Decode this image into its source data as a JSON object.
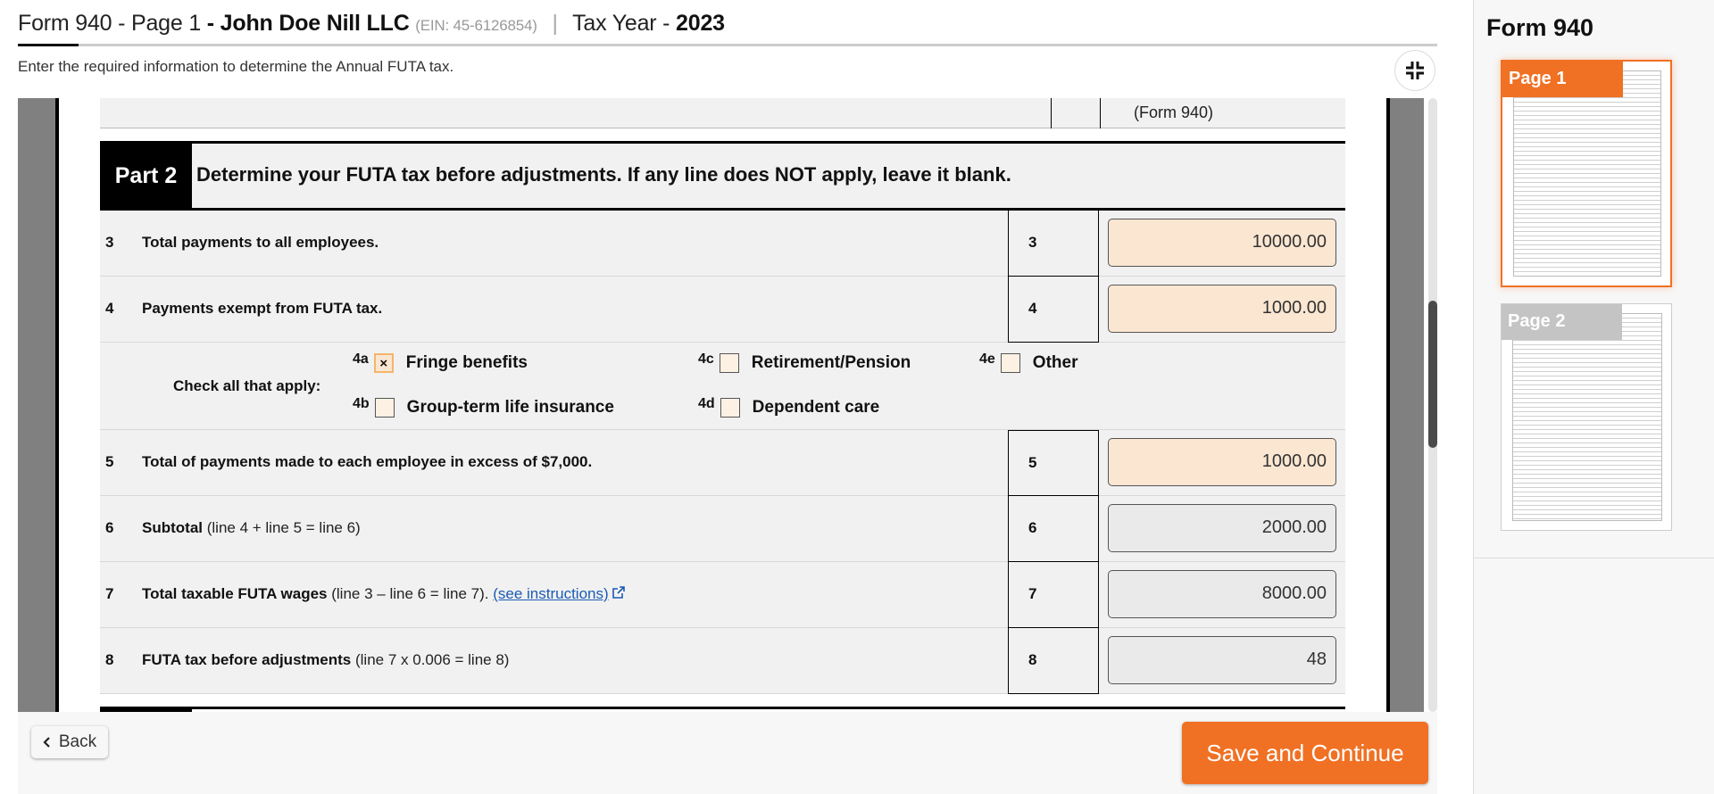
{
  "header": {
    "form_label": "Form 940 - Page 1",
    "company_prefix": " - ",
    "company": "John Doe Nill LLC",
    "ein": "(EIN: 45-6126854)",
    "separator": "|",
    "tax_year_label": "Tax Year - ",
    "tax_year": "2023",
    "subtitle": "Enter the required information to determine the Annual FUTA tax.",
    "collapse_icon": "collapse-arrows-icon"
  },
  "form": {
    "prev_row_text": "(Form 940)",
    "part": {
      "label": "Part 2",
      "title": "Determine your FUTA tax before adjustments. If any line does NOT apply, leave it blank."
    },
    "lines": [
      {
        "num": "3",
        "bold": "Total payments to all employees.",
        "rest": "",
        "line_no": "3",
        "value": "10000.00",
        "editable": true
      },
      {
        "num": "4",
        "bold": "Payments exempt from FUTA tax.",
        "rest": "",
        "line_no": "4",
        "value": "1000.00",
        "editable": true
      },
      {
        "num": "5",
        "bold": "Total of payments made to each employee in excess of $7,000.",
        "rest": "",
        "line_no": "5",
        "value": "1000.00",
        "editable": true
      },
      {
        "num": "6",
        "bold": "Subtotal",
        "rest": " (line 4 + line 5 = line 6)",
        "line_no": "6",
        "value": "2000.00",
        "editable": false
      },
      {
        "num": "7",
        "bold": "Total taxable FUTA wages",
        "rest": " (line 3 – line 6 = line 7). ",
        "link": "(see instructions)",
        "link_icon": "external-link-icon",
        "line_no": "7",
        "value": "8000.00",
        "editable": false
      },
      {
        "num": "8",
        "bold": "FUTA tax before adjustments",
        "rest": " (line 7 x 0.006 = line 8)",
        "line_no": "8",
        "value": "48",
        "editable": false
      }
    ],
    "checks": {
      "label": "Check all that apply:",
      "items": [
        {
          "code": "4a",
          "label": "Fringe benefits",
          "checked": true,
          "mark": "×"
        },
        {
          "code": "4b",
          "label": "Group-term life insurance",
          "checked": false,
          "mark": ""
        },
        {
          "code": "4c",
          "label": "Retirement/Pension",
          "checked": false,
          "mark": ""
        },
        {
          "code": "4d",
          "label": "Dependent care",
          "checked": false,
          "mark": ""
        },
        {
          "code": "4e",
          "label": "Other",
          "checked": false,
          "mark": ""
        }
      ]
    }
  },
  "scroll": {
    "thumb_start": 0.33,
    "thumb_end": 0.57
  },
  "footer": {
    "back_label": "Back",
    "back_icon": "chevron-left-icon",
    "save_label": "Save and Continue"
  },
  "sidebar": {
    "title": "Form 940",
    "pages": [
      {
        "label": "Page 1",
        "active": true
      },
      {
        "label": "Page 2",
        "active": false
      }
    ]
  },
  "colors": {
    "accent": "#f07124",
    "editable_field": "#fbe6d1",
    "readonly_field": "#eaeaea",
    "link": "#1a5bb5"
  }
}
